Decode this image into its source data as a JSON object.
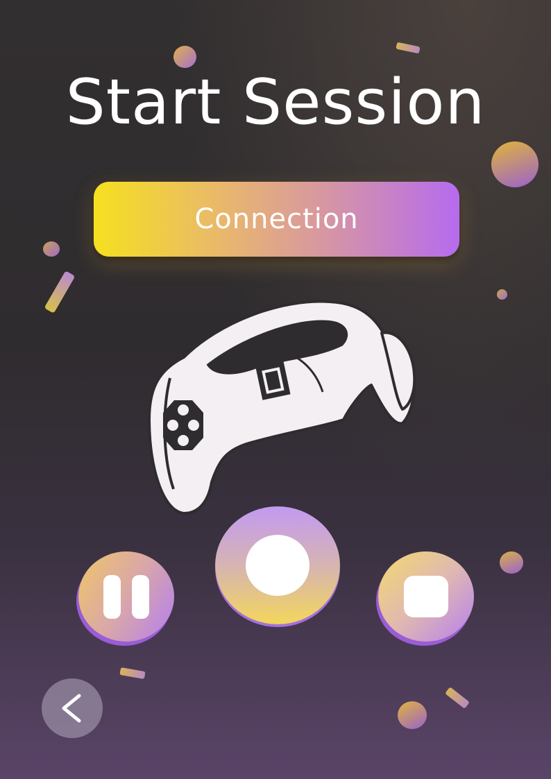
{
  "header": {
    "title": "Start Session"
  },
  "connection_button": {
    "label": "Connection"
  },
  "controls": {
    "pause_icon": "pause-icon",
    "record_icon": "record-icon",
    "stop_icon": "stop-icon"
  },
  "navigation": {
    "back_icon": "chevron-left-icon"
  },
  "illustration": {
    "icon": "gamepad-icon"
  },
  "colors": {
    "accent_yellow": "#f6e020",
    "accent_purple": "#b66bee",
    "background_dark": "#2f2c2f"
  }
}
